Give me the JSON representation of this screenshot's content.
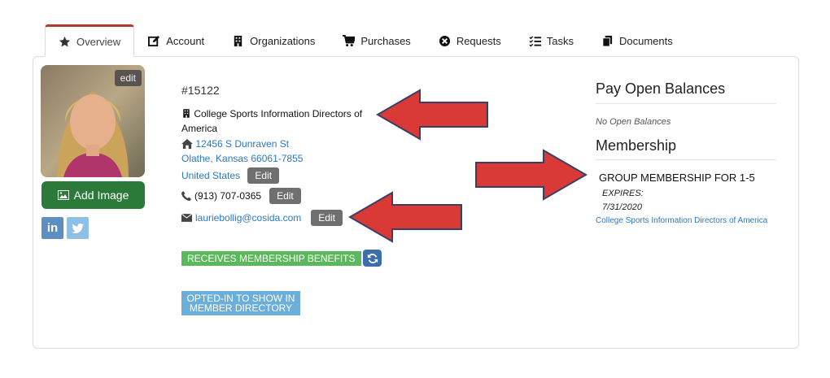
{
  "tabs": [
    {
      "label": "Overview",
      "icon": "star-icon",
      "active": true
    },
    {
      "label": "Account",
      "icon": "edit-square-icon"
    },
    {
      "label": "Organizations",
      "icon": "building-icon"
    },
    {
      "label": "Purchases",
      "icon": "cart-icon"
    },
    {
      "label": "Requests",
      "icon": "x-circle-icon"
    },
    {
      "label": "Tasks",
      "icon": "checklist-icon"
    },
    {
      "label": "Documents",
      "icon": "documents-icon"
    }
  ],
  "profile": {
    "photo_edit_label": "edit",
    "add_image_label": "Add Image",
    "social": {
      "linkedin": "in",
      "twitter": "twitter-bird-icon"
    }
  },
  "contact": {
    "record_number": "#15122",
    "organization_line1": "College Sports Information Directors of",
    "organization_line2": "America",
    "address_line1": "12456 S Dunraven St",
    "address_line2": "Olathe, Kansas 66061-7855",
    "address_country": "United States",
    "address_edit_label": "Edit",
    "phone": "(913) 707-0365",
    "phone_edit_label": "Edit",
    "email": "lauriebollig@cosida.com",
    "email_edit_label": "Edit",
    "benefits_badge": "RECEIVES MEMBERSHIP BENEFITS",
    "directory_badge_line1": "OPTED-IN TO SHOW IN",
    "directory_badge_line2": "MEMBER DIRECTORY"
  },
  "sidebar_right": {
    "pay_heading": "Pay Open Balances",
    "no_balances": "No Open Balances",
    "membership_heading": "Membership",
    "membership_name": "GROUP MEMBERSHIP FOR 1-5",
    "expires_label": "EXPIRES:",
    "expires_date": "7/31/2020",
    "membership_org": "College Sports Information Directors of America"
  },
  "colors": {
    "active_tab_accent": "#b53a30",
    "add_image_green": "#2b7a3a",
    "link_blue": "#2a78c2",
    "benefits_green": "#5cb85c",
    "directory_blue": "#6baed8",
    "annotation_arrow_red": "#d93a36"
  }
}
